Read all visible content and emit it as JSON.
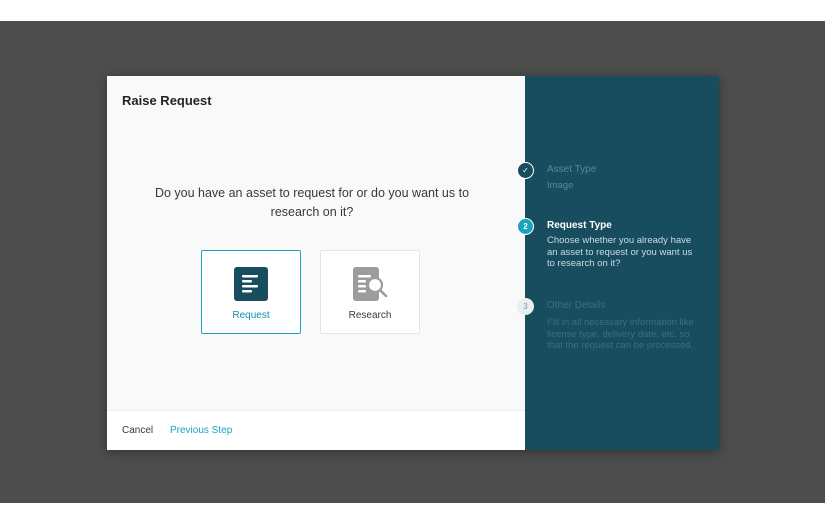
{
  "dialog": {
    "title": "Raise Request",
    "question": "Do you have an asset to request for or do you want us to research on it?",
    "options": [
      {
        "label": "Request",
        "icon": "document-list-icon",
        "selected": true
      },
      {
        "label": "Research",
        "icon": "document-search-icon",
        "selected": false
      }
    ],
    "footer": {
      "cancel_label": "Cancel",
      "previous_label": "Previous Step"
    }
  },
  "steps": [
    {
      "marker": "✓",
      "title": "Asset Type",
      "description": "Image",
      "state": "done"
    },
    {
      "marker": "2",
      "title": "Request Type",
      "description": "Choose whether you already have an asset to request or you want us to research on it?",
      "state": "active"
    },
    {
      "marker": "3",
      "title": "Other Details",
      "description": "Fill in all necessary information like license type, delivery date, etc. so that the request can be processed.",
      "state": "pending"
    }
  ],
  "colors": {
    "accent": "#1aa3c1",
    "sidebar": "#174d5f",
    "backdrop": "#4d4d4d"
  }
}
